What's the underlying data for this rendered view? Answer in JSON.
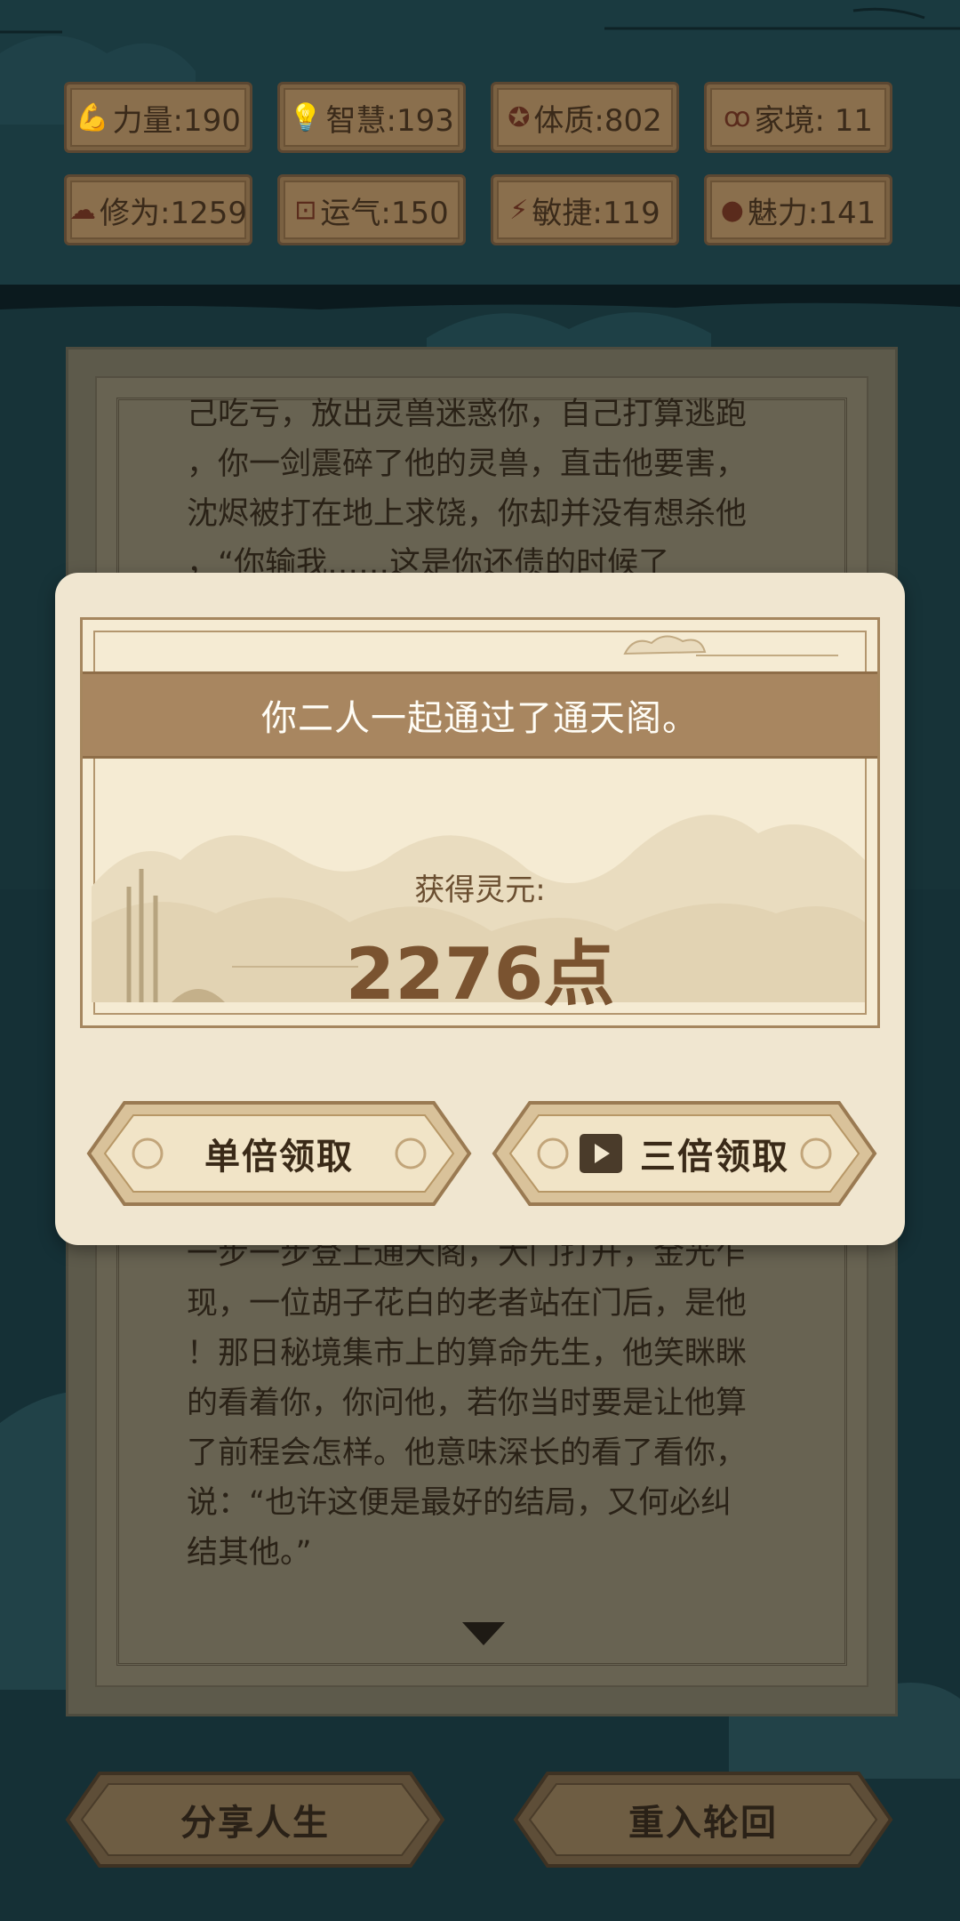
{
  "stats": [
    {
      "icon": "strength-icon",
      "glyph": "💪",
      "label": "力量:190"
    },
    {
      "icon": "wisdom-icon",
      "glyph": "💡",
      "label": "智慧:193"
    },
    {
      "icon": "constitution-icon",
      "glyph": "✪",
      "label": "体质:802"
    },
    {
      "icon": "family-icon",
      "glyph": "ꝏ",
      "label": "家境: 11"
    },
    {
      "icon": "cultivation-icon",
      "glyph": "☁",
      "label": "修为:1259"
    },
    {
      "icon": "luck-icon",
      "glyph": "⊡",
      "label": "运气:150"
    },
    {
      "icon": "agility-icon",
      "glyph": "⚡",
      "label": "敏捷:119"
    },
    {
      "icon": "charm-icon",
      "glyph": "●",
      "label": "魅力:141"
    }
  ],
  "story": {
    "top_lines": "己吃亏，放出灵兽迷惑你，自己打算逃跑\n，你一剑震碎了他的灵兽，直击他要害，\n沈烬被打在地上求饶，你却并没有想杀他\n，“你​输​我…​…​这是你还债的时候了",
    "bottom_lines": "一步一步登上通天阁，大门打开，金光乍\n现，一位胡子花白的老者站在门后，是他\n！那日秘境集市上的算命先生，他笑眯眯\n的看着你，你问他，若你当时要是让他算\n了前程会怎样。他意味深长的看了看你，\n说：“也许这便是最好的结局，又何必纠\n结其他。”"
  },
  "bottom_buttons": {
    "share": "分享人生",
    "rebirth": "重入轮回"
  },
  "dialog": {
    "banner": "你二人一起通过了通天阁。",
    "reward_label": "获得灵元:",
    "reward_value": "2276点",
    "single_claim": "单倍领取",
    "triple_claim": "三倍领取"
  },
  "colors": {
    "background": "#153036",
    "dialog_bg": "#f0e6d0",
    "banner": "#a88660",
    "reward_text": "#7a5330"
  }
}
